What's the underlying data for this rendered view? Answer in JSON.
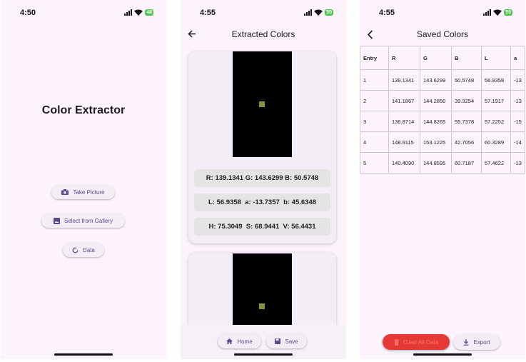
{
  "status": {
    "time1": "4:50",
    "time2": "4:55",
    "time3": "4:55",
    "battery1": "48",
    "battery2": "50",
    "battery3": "50"
  },
  "home": {
    "title": "Color Extractor",
    "take_picture": "Take Picture",
    "select_gallery": "Select from Gallery",
    "data": "Data"
  },
  "extracted": {
    "title": "Extracted Colors",
    "card1": {
      "rgb": "R: 139.1341 G: 143.6299 B: 50.5748",
      "lab": "L: 56.9358  a: -13.7357  b: 45.6348",
      "hsv": "H: 75.3049  S: 68.9441  V: 56.4431",
      "swatch_color": "#8b903a"
    },
    "home_button": "Home",
    "save_button": "Save"
  },
  "saved": {
    "title": "Saved Colors",
    "headers": [
      "Entry",
      "R",
      "G",
      "B",
      "L",
      "a"
    ],
    "rows": [
      [
        "1",
        "139.1341",
        "143.6299",
        "50.5748",
        "56.9358",
        "-13"
      ],
      [
        "2",
        "141.1867",
        "144.2850",
        "39.3254",
        "57.1917",
        "-13"
      ],
      [
        "3",
        "136.8714",
        "144.8265",
        "55.7378",
        "57.2252",
        "-15"
      ],
      [
        "4",
        "148.9115",
        "153.1225",
        "42.7056",
        "60.3289",
        "-14"
      ],
      [
        "5",
        "140.4090",
        "144.8595",
        "60.7187",
        "57.4622",
        "-13"
      ]
    ],
    "clear_button": "Clear All Data",
    "export_button": "Export"
  },
  "colors": {
    "accent": "#5b4a8a",
    "danger": "#e53935",
    "background": "#fdf3fc"
  }
}
